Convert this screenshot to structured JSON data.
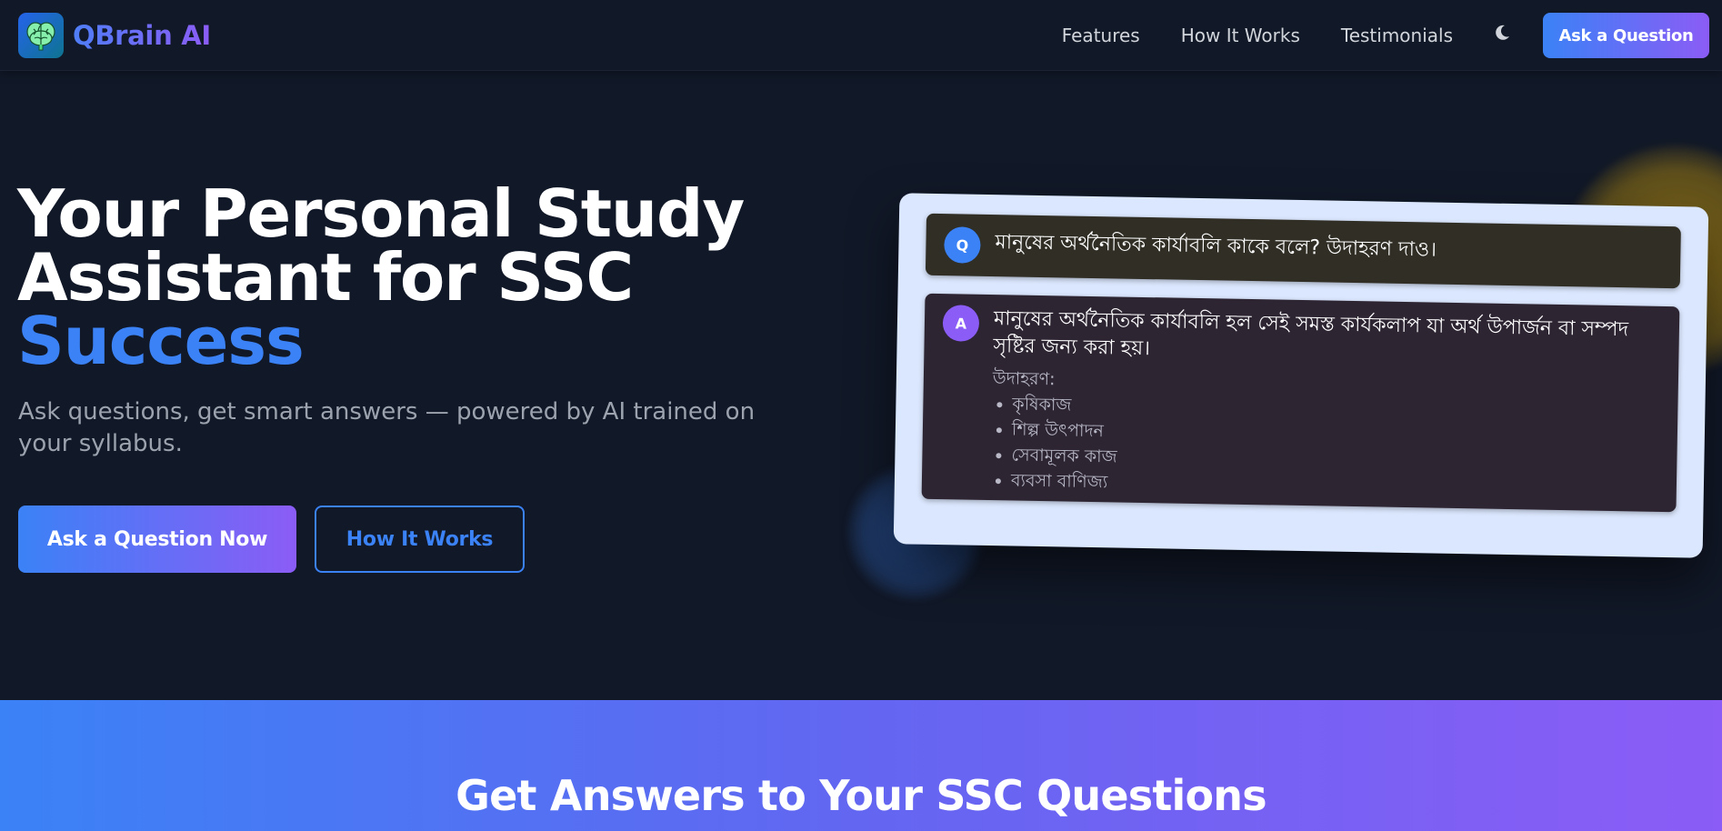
{
  "brand": {
    "name": "QBrain AI",
    "icon": "brain-icon"
  },
  "nav": {
    "links": [
      "Features",
      "How It Works",
      "Testimonials"
    ],
    "theme_icon": "moon-icon",
    "cta_label": "Ask a Question"
  },
  "hero": {
    "title_line1": "Your Personal Study",
    "title_line2": "Assistant for SSC",
    "title_accent": "Success",
    "subtitle": "Ask questions, get smart answers — powered by AI trained on your syllabus.",
    "primary_button": "Ask a Question Now",
    "secondary_button": "How It Works"
  },
  "chat": {
    "question": {
      "avatar": "Q",
      "text": "মানুষের অর্থনৈতিক কার্যাবলি কাকে বলে? উদাহরণ দাও।"
    },
    "answer": {
      "avatar": "A",
      "text": "মানুষের অর্থনৈতিক কার্যাবলি হল সেই সমস্ত কার্যকলাপ যা অর্থ উপার্জন বা সম্পদ সৃষ্টির জন্য করা হয়।",
      "examples_label": "উদাহরণ:",
      "examples": [
        "কৃষিকাজ",
        "শিল্প উৎপাদন",
        "সেবামূলক কাজ",
        "ব্যবসা বাণিজ্য"
      ]
    }
  },
  "section": {
    "title": "Get Answers to Your SSC Questions"
  },
  "colors": {
    "background": "#111827",
    "accent_blue": "#3b82f6",
    "accent_purple": "#8b5cf6",
    "card": "#dbe7fe"
  }
}
